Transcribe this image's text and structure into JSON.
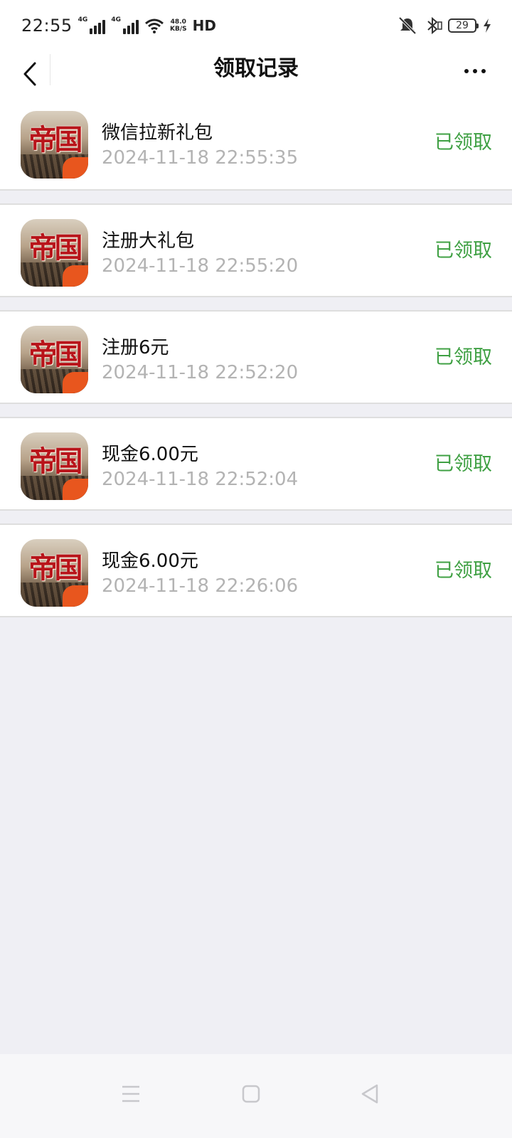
{
  "status_bar": {
    "time": "22:55",
    "network_1": "4G",
    "network_2": "4G",
    "speed_value": "48.0",
    "speed_unit": "KB/S",
    "hd_label": "HD",
    "battery": "29"
  },
  "nav": {
    "title": "领取记录"
  },
  "records": [
    {
      "title": "微信拉新礼包",
      "time": "2024-11-18 22:55:35",
      "status": "已领取",
      "icon_text": "帝国"
    },
    {
      "title": "注册大礼包",
      "time": "2024-11-18 22:55:20",
      "status": "已领取",
      "icon_text": "帝国"
    },
    {
      "title": "注册6元",
      "time": "2024-11-18 22:52:20",
      "status": "已领取",
      "icon_text": "帝国"
    },
    {
      "title": "现金6.00元",
      "time": "2024-11-18 22:52:04",
      "status": "已领取",
      "icon_text": "帝国"
    },
    {
      "title": "现金6.00元",
      "time": "2024-11-18 22:26:06",
      "status": "已领取",
      "icon_text": "帝国"
    }
  ],
  "colors": {
    "status_green": "#3FA043",
    "page_bg": "#EFEFF4",
    "time_gray": "#B3B3B3"
  },
  "icons": {
    "back": "chevron-left-icon",
    "more": "more-dots-icon",
    "sys_menu": "menu-icon",
    "sys_home": "home-square-icon",
    "sys_back": "triangle-back-icon"
  }
}
